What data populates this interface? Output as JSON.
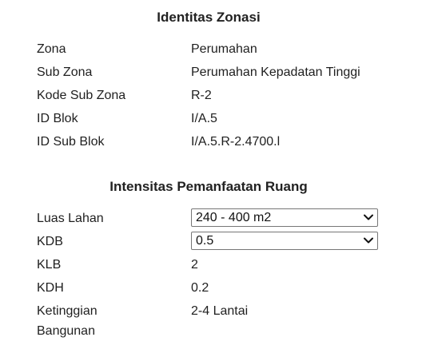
{
  "identitas": {
    "title": "Identitas Zonasi",
    "rows": [
      {
        "label": "Zona",
        "value": "Perumahan"
      },
      {
        "label": "Sub Zona",
        "value": "Perumahan Kepadatan Tinggi"
      },
      {
        "label": "Kode Sub Zona",
        "value": "R-2"
      },
      {
        "label": "ID Blok",
        "value": "I/A.5"
      },
      {
        "label": "ID Sub Blok",
        "value": "I/A.5.R-2.4700.l"
      }
    ]
  },
  "intensitas": {
    "title": "Intensitas Pemanfaatan Ruang",
    "luas_lahan": {
      "label": "Luas Lahan",
      "selected": "240 - 400 m2"
    },
    "kdb": {
      "label": "KDB",
      "selected": "0.5"
    },
    "rows": [
      {
        "label": "KLB",
        "value": "2"
      },
      {
        "label": "KDH",
        "value": "0.2"
      },
      {
        "label_line1": "Ketinggian",
        "label_line2": "Bangunan",
        "value": "2-4 Lantai"
      }
    ]
  }
}
